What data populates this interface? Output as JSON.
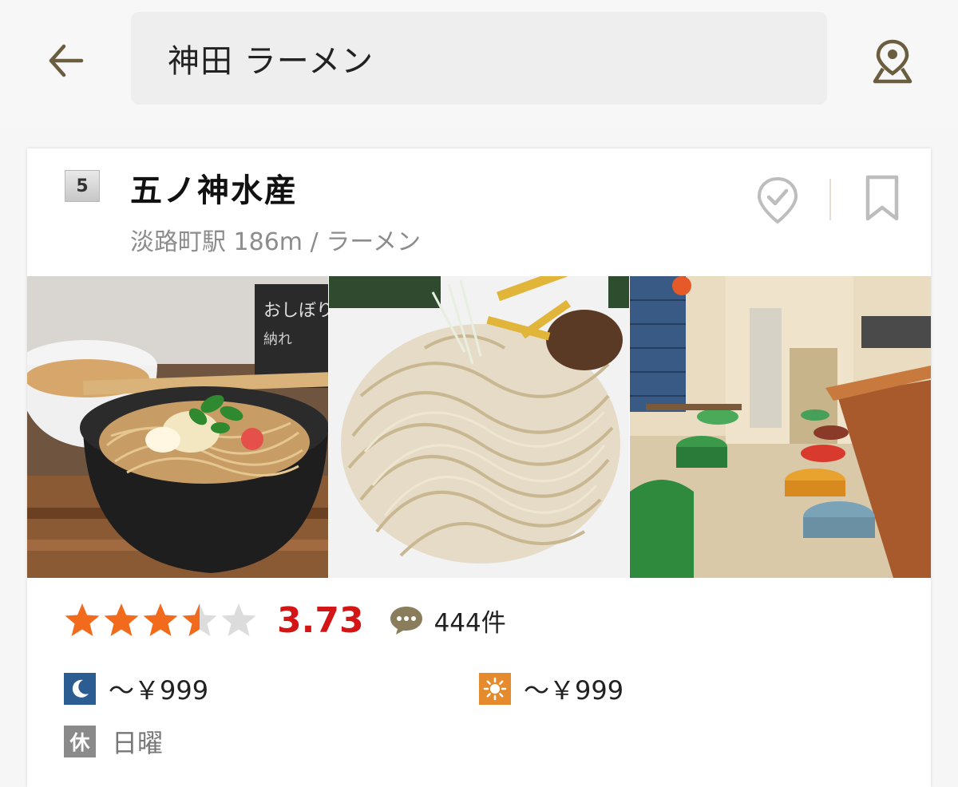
{
  "search": {
    "query": "神田 ラーメン"
  },
  "icons": {
    "back": "arrow-left-icon",
    "map": "map-pin-icon",
    "visited": "check-pin-icon",
    "bookmark": "bookmark-icon",
    "review": "speech-bubble-icon",
    "dinner": "moon-icon",
    "lunch": "sun-icon"
  },
  "colors": {
    "accent": "#6b5d3f",
    "score": "#d31515",
    "star": "#f26b1d",
    "dinner_badge": "#2c5d92",
    "lunch_badge": "#e68a2e"
  },
  "shop": {
    "rank": "5",
    "name": "五ノ神水産",
    "station_genre": "淡路町駅 186m / ラーメン",
    "rating": {
      "stars": 3.5,
      "score": "3.73"
    },
    "reviews": "444件",
    "photos": [
      "tsukemen-photo",
      "noodles-closeup-photo",
      "interior-photo"
    ],
    "dinner_price": "～￥999",
    "lunch_price": "～￥999",
    "closed_badge": "休",
    "closed_days": "日曜"
  }
}
